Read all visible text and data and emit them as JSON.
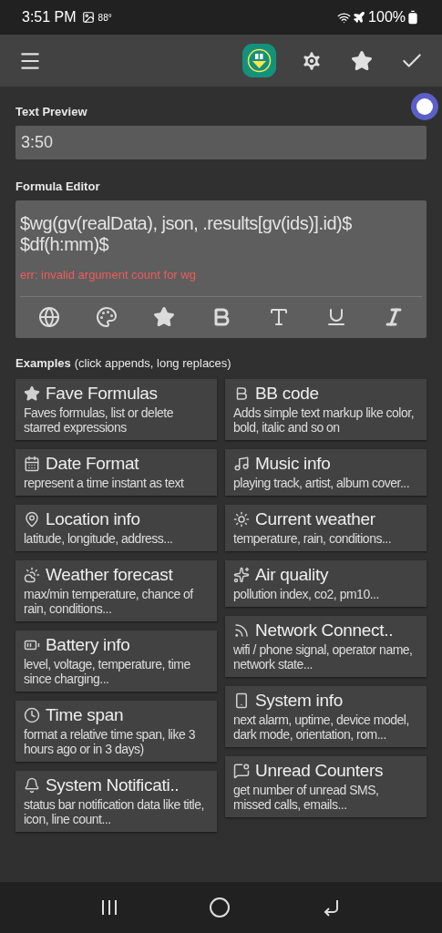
{
  "status_bar": {
    "time": "3:51 PM",
    "temperature": "88°",
    "battery": "100%"
  },
  "text_preview": {
    "label": "Text Preview",
    "value": "3:50"
  },
  "formula_editor": {
    "label": "Formula Editor",
    "value": "$wg(gv(realData), json, .results[gv(ids)].id)$ $df(h:mm)$",
    "error": "err: invalid argument count for wg"
  },
  "examples": {
    "label": "Examples",
    "hint": "(click appends, long replaces)",
    "left": [
      {
        "title": "Fave Formulas",
        "description": "Faves formulas, list or delete starred expressions"
      },
      {
        "title": "Date Format",
        "description": "represent a time instant as text"
      },
      {
        "title": "Location info",
        "description": "latitude, longitude, address..."
      },
      {
        "title": "Weather forecast",
        "description": "max/min temperature, chance of rain, conditions..."
      },
      {
        "title": "Battery info",
        "description": "level, voltage, temperature, time since charging..."
      },
      {
        "title": "Time span",
        "description": "format a relative time span, like 3 hours ago or in 3 days)"
      },
      {
        "title": "System Notificati..",
        "description": "status bar notification data like title, icon, line count..."
      }
    ],
    "right": [
      {
        "title": "BB code",
        "description": "Adds simple text markup like color, bold, italic and so on"
      },
      {
        "title": "Music info",
        "description": "playing track, artist, album cover..."
      },
      {
        "title": "Current weather",
        "description": "temperature, rain, conditions..."
      },
      {
        "title": "Air quality",
        "description": "pollution index, co2, pm10..."
      },
      {
        "title": "Network Connect..",
        "description": "wifi / phone signal, operator name, network state..."
      },
      {
        "title": "System info",
        "description": "next alarm, uptime, device model, dark mode, orientation, rom..."
      },
      {
        "title": "Unread Counters",
        "description": "get number of unread SMS, missed calls, emails..."
      }
    ]
  }
}
